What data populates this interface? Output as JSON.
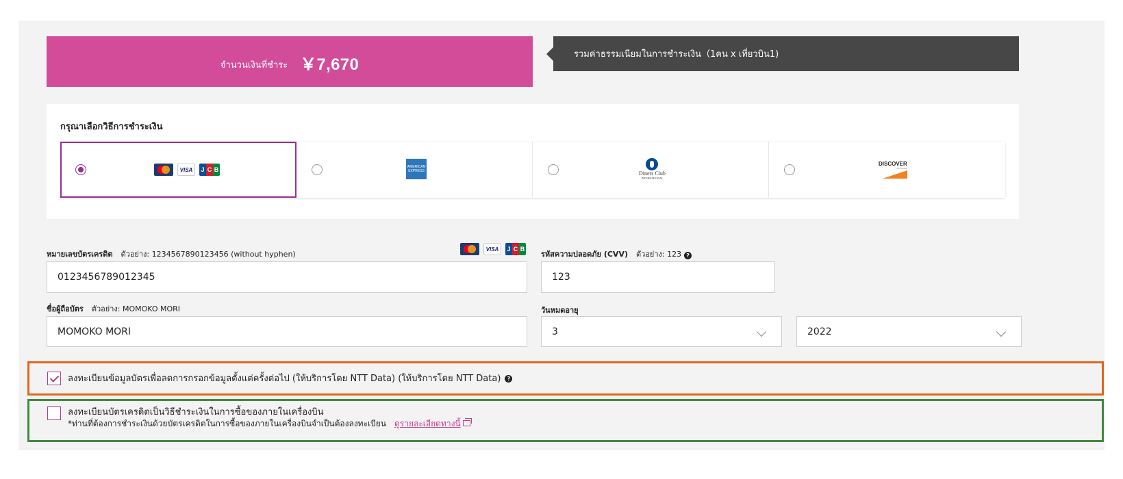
{
  "payment": {
    "amount_label": "จำนวนเงินที่ชำระ",
    "amount_value": "￥7,670",
    "fee_note": "รวมค่าธรรมเนียมในการชำระเงิน（1คน x เที่ยวบิน1)"
  },
  "methods": {
    "heading": "กรุณาเลือกวิธีการชำระเงิน",
    "options": [
      {
        "name": "mastercard-visa-jcb",
        "selected": true
      },
      {
        "name": "american-express",
        "selected": false,
        "logo_lines": [
          "AMERICAN",
          "EXPRESS"
        ]
      },
      {
        "name": "diners-club",
        "selected": false,
        "logo_text": "Diners Club",
        "logo_sub": "INTERNATIONAL"
      },
      {
        "name": "discover",
        "selected": false,
        "logo_text": "DISCOVER",
        "logo_sub": "NETWORK"
      }
    ]
  },
  "logos": {
    "visa": "VISA",
    "jcb": [
      "J",
      "C",
      "B"
    ]
  },
  "form": {
    "card_number": {
      "label": "หมายเลขบัตรเครดิต",
      "example": "ตัวอย่าง: 1234567890123456 (without hyphen)",
      "value": "0123456789012345"
    },
    "cvv": {
      "label": "รหัสความปลอดภัย (CVV)",
      "example": "ตัวอย่าง: 123",
      "value": "123"
    },
    "holder": {
      "label": "ชื่อผู้ถือบัตร",
      "example": "ตัวอย่าง: MOMOKO MORI",
      "value": "MOMOKO MORI"
    },
    "expiry": {
      "label": "วันหมดอายุ",
      "month": "3",
      "year": "2022"
    }
  },
  "options": {
    "save_card": {
      "checked": true,
      "text": "ลงทะเบียนข้อมูลบัตรเพื่อลดการกรอกข้อมูลตั้งแต่ครั้งต่อไป (ให้บริการโดย NTT Data) (ให้บริการโดย NTT Data)"
    },
    "inflight": {
      "checked": false,
      "text": "ลงทะเบียนบัตรเครดิตเป็นวิธีชำระเงินในการซื้อของภายในเครื่องบิน",
      "subtext": "*ท่านที่ต้องการชำระเงินด้วยบัตรเครดิตในการซื้อของภายในเครื่องบินจำเป็นต้องลงทะเบียน",
      "link": "ดูรายละเอียดทางนี้"
    }
  },
  "colors": {
    "accent": "#d24c99",
    "selected_border": "#9b2d8f",
    "note_bg": "#474747",
    "box_orange": "#e0661a",
    "box_green": "#3e8a3e"
  }
}
